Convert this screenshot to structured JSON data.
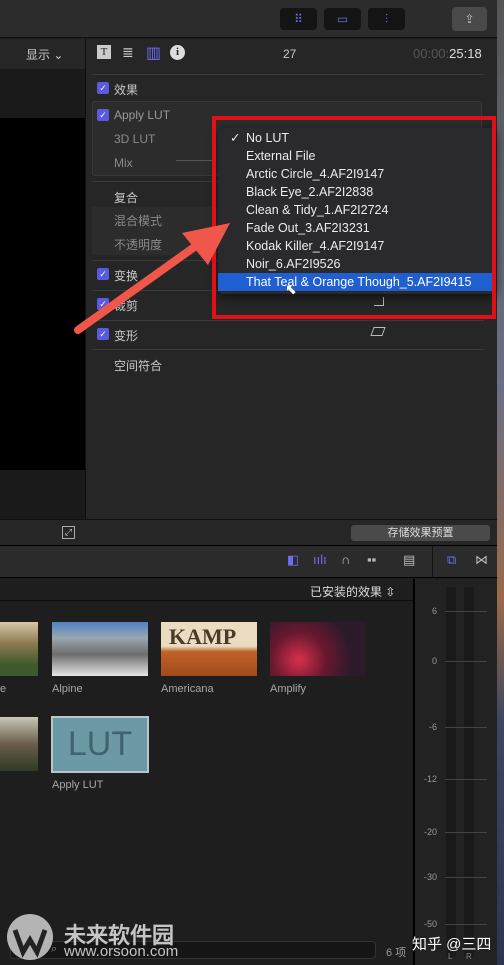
{
  "toolbar": {
    "buttons": [
      {
        "icon": "grid-icon",
        "glyph": "⠿"
      },
      {
        "icon": "filmstrip-icon",
        "glyph": "▭"
      },
      {
        "icon": "sliders-icon",
        "glyph": "⫶"
      }
    ],
    "share_icon": "share-icon"
  },
  "viewer": {
    "display_menu": "显示 ⌄"
  },
  "inspector": {
    "tabs": [
      "T",
      "≣",
      "▥",
      "i"
    ],
    "frame": "27",
    "timecode_dim": "00:00:",
    "timecode": "25:18",
    "sections": {
      "effects": "效果",
      "apply_lut": "Apply LUT",
      "lut_3d": "3D LUT",
      "mix": "Mix",
      "composite": "复合",
      "blend_mode": "混合模式",
      "opacity": "不透明度",
      "transform": "变换",
      "crop": "裁剪",
      "distort": "变形",
      "spatial_conform": "空间符合"
    },
    "save_preset": "存储效果预置"
  },
  "lut_menu": {
    "items": [
      "No LUT",
      "External File",
      "Arctic Circle_4.AF2I9147",
      "Black Eye_2.AF2I2838",
      "Clean & Tidy_1.AF2I2724",
      "Fade Out_3.AF2I3231",
      "Kodak Killer_4.AF2I9147",
      "Noir_6.AF2I9526",
      "That Teal & Orange Though_5.AF2I9415"
    ],
    "checked": "No LUT",
    "highlighted": "That Teal & Orange Though_5.AF2I9415"
  },
  "browser": {
    "category": "已安装的效果",
    "effects": [
      "Alpine",
      "Americana",
      "Amplify",
      "Apply LUT"
    ],
    "partial_label": "e",
    "count": "6 项"
  },
  "meter": {
    "scale": [
      "6",
      "0",
      "-6",
      "-12",
      "-20",
      "-30",
      "-50"
    ],
    "channels": [
      "L",
      "R"
    ]
  },
  "watermark": {
    "brand": "未来软件园",
    "url": "www.orsoon.com",
    "credit": "知乎 @三四"
  },
  "colors": {
    "accent": "#5a5ae0",
    "highlight": "#1f5fd0",
    "annotation": "#e01018",
    "arrow": "#f0574a"
  }
}
